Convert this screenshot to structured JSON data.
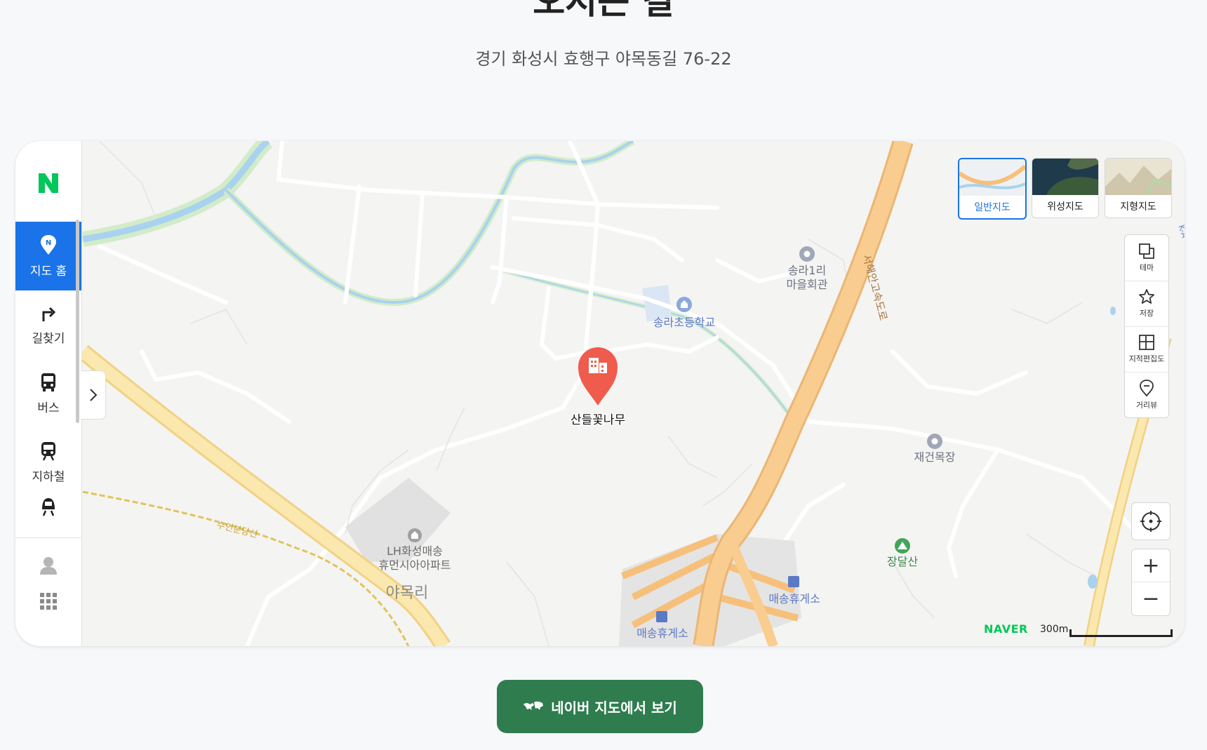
{
  "page": {
    "title": "오시는 길",
    "address": "경기 화성시 효행구 야목동길 76-22"
  },
  "sidebar": {
    "logo": "N",
    "items": [
      {
        "label": "지도 홈",
        "icon": "map-pin-icon",
        "active": true
      },
      {
        "label": "길찾기",
        "icon": "turn-right-arrow-icon",
        "active": false
      },
      {
        "label": "버스",
        "icon": "bus-icon",
        "active": false
      },
      {
        "label": "지하철",
        "icon": "subway-icon",
        "active": false
      },
      {
        "label": "",
        "icon": "train-icon",
        "active": false
      }
    ],
    "bottom_icons": [
      "user-icon",
      "grid-icon"
    ]
  },
  "map_types": [
    {
      "label": "일반지도",
      "selected": true
    },
    {
      "label": "위성지도",
      "selected": false
    },
    {
      "label": "지형지도",
      "selected": false
    }
  ],
  "map_tools": [
    {
      "label": "테마",
      "icon": "layers-icon"
    },
    {
      "label": "저장",
      "icon": "star-icon"
    },
    {
      "label": "지적편집도",
      "icon": "cadastral-icon"
    },
    {
      "label": "거리뷰",
      "icon": "street-view-icon"
    }
  ],
  "map_labels": {
    "target": "산들꽃나무",
    "school": "송라초등학교",
    "hall_1": "송라1리",
    "hall_2": "마을회관",
    "highway": "서해안고속도로",
    "farm": "재건목장",
    "mountain": "장달산",
    "rest_area_1": "매송휴게소",
    "rest_area_2": "매송휴게소",
    "apartment_1": "LH화성매송",
    "apartment_2": "휴먼시아아파트",
    "village": "야목리",
    "railway": "수인분당선",
    "edge_road": "K-A"
  },
  "controls": {
    "zoom_in": "+",
    "zoom_out": "−"
  },
  "attribution": "NAVER",
  "scale": "300m",
  "cta": {
    "label": "네이버 지도에서 보기"
  },
  "colors": {
    "brand_green": "#03c75a",
    "active_blue": "#1a73e8",
    "cta_green": "#2f7d4f",
    "pin_red": "#ef5b4c",
    "highway_orange": "#f7c88a"
  }
}
